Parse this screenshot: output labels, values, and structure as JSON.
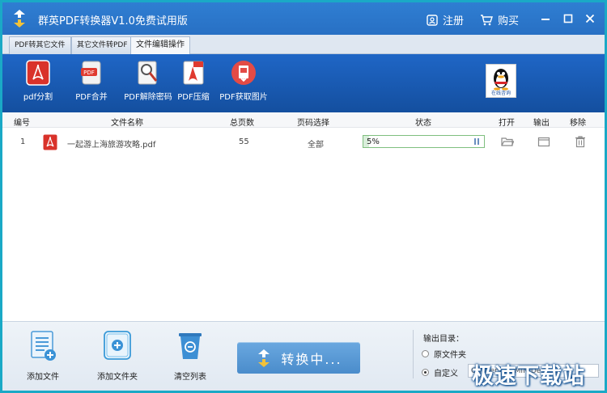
{
  "window": {
    "title": "群英PDF转换器V1.0免费试用版",
    "register_label": "注册",
    "buy_label": "购买"
  },
  "tabs": [
    {
      "label": "PDF转其它文件"
    },
    {
      "label": "其它文件转PDF"
    },
    {
      "label": "文件编辑操作"
    }
  ],
  "toolbar": {
    "tools": [
      {
        "label": "pdf分割"
      },
      {
        "label": "PDF合并"
      },
      {
        "label": "PDF解除密码"
      },
      {
        "label": "PDF压缩"
      },
      {
        "label": "PDF获取图片"
      }
    ],
    "qq_label": "在线咨询"
  },
  "table": {
    "headers": [
      "编号",
      "文件名称",
      "总页数",
      "页码选择",
      "状态",
      "打开",
      "输出",
      "移除"
    ],
    "rows": [
      {
        "no": "1",
        "filename": "一起游上海旅游攻略.pdf",
        "pages": "55",
        "page_select": "全部",
        "progress_text": "5%",
        "progress_fraction": 0.05
      }
    ]
  },
  "bottom": {
    "add_file_label": "添加文件",
    "add_folder_label": "添加文件夹",
    "clear_list_label": "清空列表",
    "convert_label": "转换中...",
    "output_dir_label": "输出目录：",
    "option_source_label": "原文件夹",
    "option_custom_label": "自定义",
    "output_path": "C:\\Users\\ADMIN\\Desktop",
    "selected_option": "custom"
  },
  "watermark": "极速下载站",
  "colors": {
    "titlebar": "#2870c4",
    "toolbar": "#1a5db4",
    "frame": "#1aa9c6",
    "pdf_red": "#d9322a",
    "progress_border": "#7fbf7f"
  }
}
